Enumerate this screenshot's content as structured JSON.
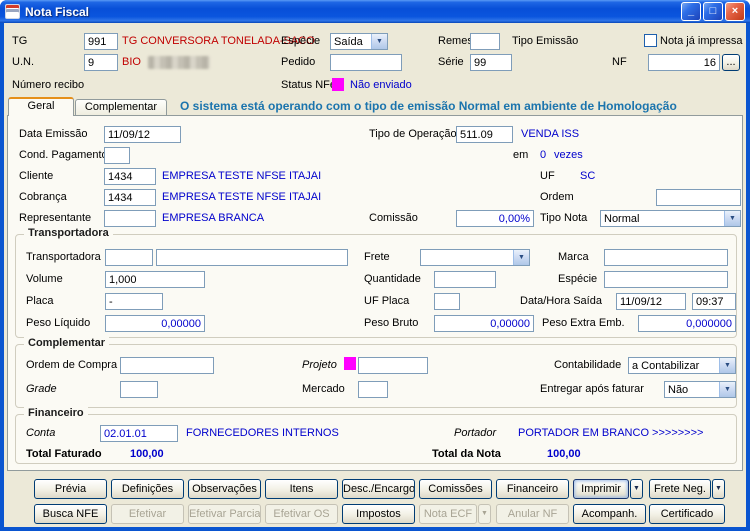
{
  "window": {
    "title": "Nota Fiscal"
  },
  "icons": {
    "minimize": "_",
    "maximize": "□",
    "close": "×",
    "dropdown": "▼",
    "browse": "..."
  },
  "header": {
    "tg": {
      "label": "TG",
      "value": "991",
      "desc": "TG CONVERSORA TONELADA-SACO"
    },
    "especie": {
      "label": "Espécie",
      "value": "Saída"
    },
    "remessa": {
      "label": "Remessa",
      "value": ""
    },
    "tipo_emissao": {
      "label": "Tipo Emissão"
    },
    "nota_ja_impressa": {
      "label": "Nota já impressa"
    },
    "un": {
      "label": "U.N.",
      "value": "9",
      "desc": "BIO"
    },
    "pedido": {
      "label": "Pedido",
      "value": ""
    },
    "serie": {
      "label": "Série",
      "value": "99"
    },
    "nf": {
      "label": "NF",
      "value": "16"
    },
    "numero_recibo": {
      "label": "Número recibo"
    },
    "status_nfe": {
      "label": "Status NFe",
      "value": "Não enviado"
    }
  },
  "tabs": {
    "geral": "Geral",
    "complementar": "Complementar"
  },
  "warning": "O sistema está operando com o tipo de emissão Normal em ambiente de Homologação",
  "geral": {
    "data_emissao": {
      "label": "Data Emissão",
      "value": "11/09/12"
    },
    "tipo_operacao": {
      "label": "Tipo de Operação",
      "value": "511.09",
      "desc": "VENDA ISS"
    },
    "cond_pagamento": {
      "label": "Cond. Pagamento",
      "value": ""
    },
    "em": {
      "label": "em",
      "value": "0",
      "suffix": "vezes"
    },
    "cliente": {
      "label": "Cliente",
      "value": "1434",
      "desc": "EMPRESA TESTE NFSE ITAJAI"
    },
    "uf": {
      "label": "UF",
      "value": "SC"
    },
    "cobranca": {
      "label": "Cobrança",
      "value": "1434",
      "desc": "EMPRESA TESTE NFSE ITAJAI"
    },
    "ordem": {
      "label": "Ordem",
      "value": ""
    },
    "representante": {
      "label": "Representante",
      "value": "",
      "desc": "EMPRESA BRANCA"
    },
    "comissao": {
      "label": "Comissão",
      "value": "0,00%"
    },
    "tipo_nota": {
      "label": "Tipo Nota",
      "value": "Normal"
    }
  },
  "transportadora": {
    "title": "Transportadora",
    "transportadora": {
      "label": "Transportadora",
      "code": "",
      "name": ""
    },
    "frete": {
      "label": "Frete",
      "value": ""
    },
    "marca": {
      "label": "Marca",
      "value": ""
    },
    "volume": {
      "label": "Volume",
      "value": "1,000"
    },
    "quantidade": {
      "label": "Quantidade",
      "value": ""
    },
    "especie": {
      "label": "Espécie",
      "value": ""
    },
    "placa": {
      "label": "Placa",
      "value": "-"
    },
    "uf_placa": {
      "label": "UF Placa",
      "value": ""
    },
    "data_hora_saida": {
      "label": "Data/Hora Saída",
      "date": "11/09/12",
      "time": "09:37"
    },
    "peso_liquido": {
      "label": "Peso Líquido",
      "value": "0,00000"
    },
    "peso_bruto": {
      "label": "Peso Bruto",
      "value": "0,00000"
    },
    "peso_extra": {
      "label": "Peso Extra Emb.",
      "value": "0,000000"
    }
  },
  "complementar": {
    "title": "Complementar",
    "ordem_compra": {
      "label": "Ordem de Compra",
      "value": ""
    },
    "projeto": {
      "label": "Projeto",
      "value": ""
    },
    "contabilidade": {
      "label": "Contabilidade",
      "value": "a Contabilizar"
    },
    "grade": {
      "label": "Grade",
      "value": ""
    },
    "mercado": {
      "label": "Mercado",
      "value": ""
    },
    "entregar": {
      "label": "Entregar após faturar",
      "value": "Não"
    }
  },
  "financeiro": {
    "title": "Financeiro",
    "conta": {
      "label": "Conta",
      "value": "02.01.01",
      "desc": "FORNECEDORES INTERNOS"
    },
    "portador": {
      "label": "Portador",
      "desc": "PORTADOR EM BRANCO >>>>>>>>"
    },
    "total_faturado": {
      "label": "Total Faturado",
      "value": "100,00"
    },
    "total_nota": {
      "label": "Total da Nota",
      "value": "100,00"
    }
  },
  "buttons": {
    "row1": [
      {
        "label": "Prévia",
        "enabled": true
      },
      {
        "label": "Definições",
        "enabled": true
      },
      {
        "label": "Observações",
        "enabled": true
      },
      {
        "label": "Itens",
        "enabled": true
      },
      {
        "label": "Desc./Encargos",
        "enabled": true
      },
      {
        "label": "Comissões",
        "enabled": true
      },
      {
        "label": "Financeiro",
        "enabled": true
      },
      {
        "label": "Imprimir",
        "enabled": true
      },
      {
        "label": "Frete Neg.",
        "enabled": true
      }
    ],
    "row2": [
      {
        "label": "Busca NFE",
        "enabled": true
      },
      {
        "label": "Efetivar",
        "enabled": false
      },
      {
        "label": "Efetivar Parcial",
        "enabled": false
      },
      {
        "label": "Efetivar OS",
        "enabled": false
      },
      {
        "label": "Impostos",
        "enabled": true
      },
      {
        "label": "Nota ECF",
        "enabled": false
      },
      {
        "label": "Anular NF",
        "enabled": false
      },
      {
        "label": "Acompanh.",
        "enabled": true
      },
      {
        "label": "Certificado",
        "enabled": true
      }
    ]
  },
  "colors": {
    "value_blue": "#0000CC",
    "desc_red": "#C00000",
    "status_magenta": "#FF00FF",
    "warning_blue": "#1B74AD",
    "titlebar_blue": "#084FD8"
  }
}
